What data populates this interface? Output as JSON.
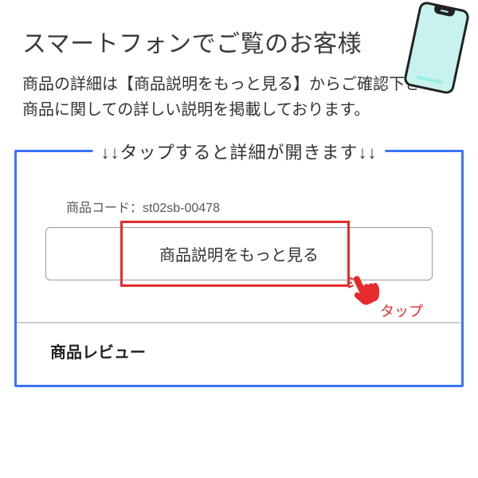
{
  "header": {
    "title": "スマートフォンでご覧のお客様"
  },
  "lead": {
    "line1": "商品の詳細は【商品説明をもっと見る】からご確認下さい。",
    "line2": "商品に関しての詳しい説明を掲載しております。"
  },
  "instruction": {
    "legend": "↓↓タップすると詳細が開きます↓↓",
    "product_code_label": "商品コード：",
    "product_code_value": "st02sb-00478",
    "more_button_label": "商品説明をもっと見る",
    "tap_label": "タップ",
    "review_heading": "商品レビュー"
  },
  "colors": {
    "accent_blue": "#3a74ff",
    "highlight_red": "#e52b2b",
    "phone_screen": "#c7f2ee"
  }
}
